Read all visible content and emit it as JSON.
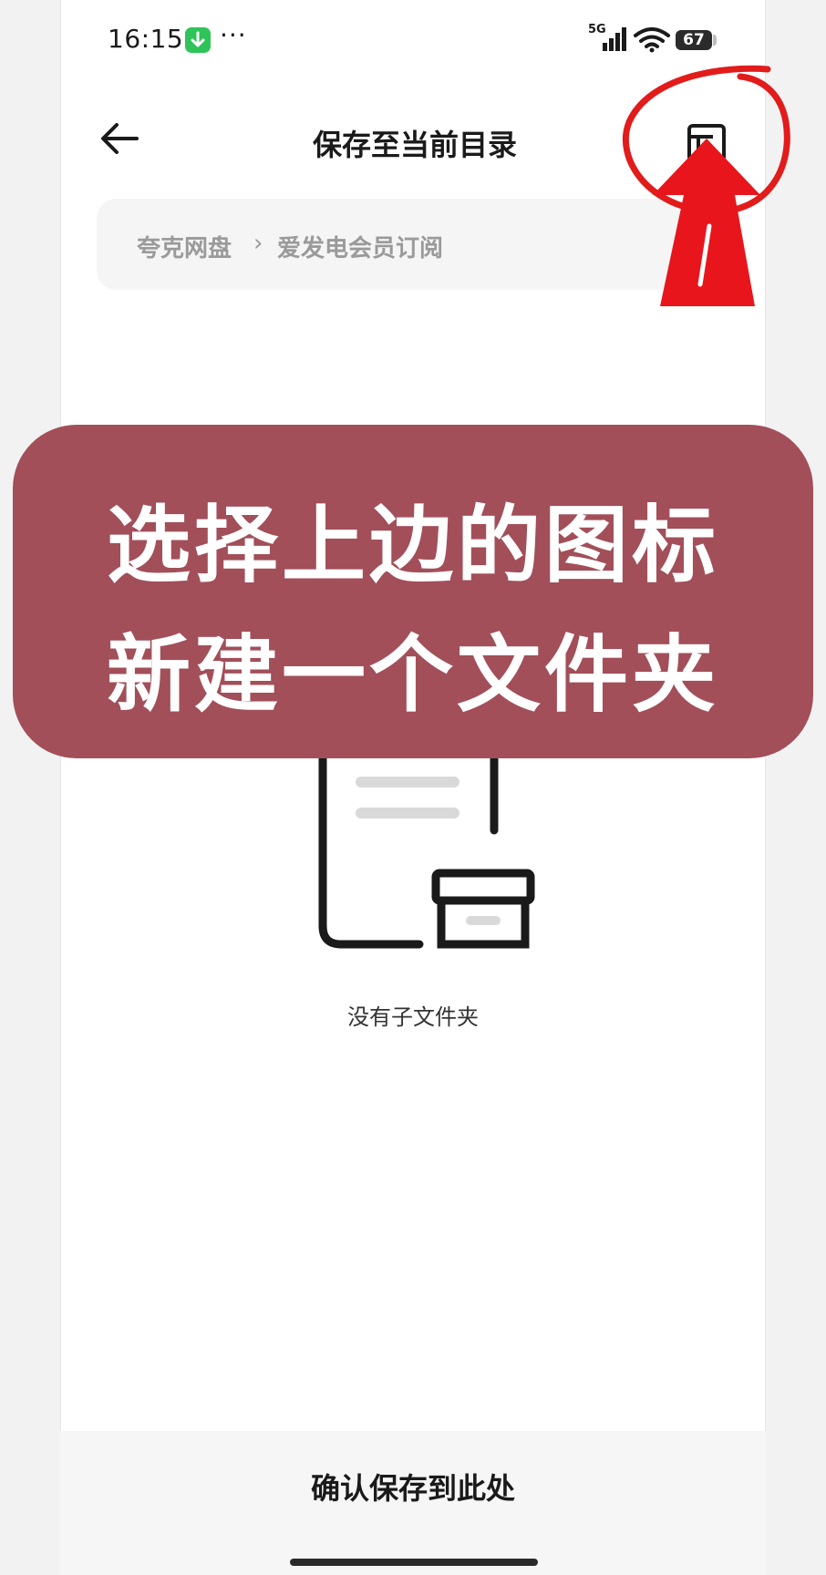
{
  "status_bar": {
    "time": "16:15",
    "more": "···",
    "network": "5G",
    "battery": "67",
    "download_icon": "download-icon",
    "accent_color": "#2fc45a"
  },
  "header": {
    "title": "保存至当前目录",
    "back_icon": "back-arrow-icon",
    "new_folder_icon": "new-folder-icon"
  },
  "breadcrumb": {
    "items": [
      "夸克网盘",
      "爱发电会员订阅"
    ],
    "separator": "›"
  },
  "annotation": {
    "lines": [
      "选择上边的图标",
      "新建一个文件夹"
    ],
    "background_color": "#a24f59",
    "highlight_color": "#e21b1b"
  },
  "empty_state": {
    "message": "没有子文件夹",
    "icon": "empty-folder-illustration"
  },
  "footer": {
    "confirm_label": "确认保存到此处"
  }
}
